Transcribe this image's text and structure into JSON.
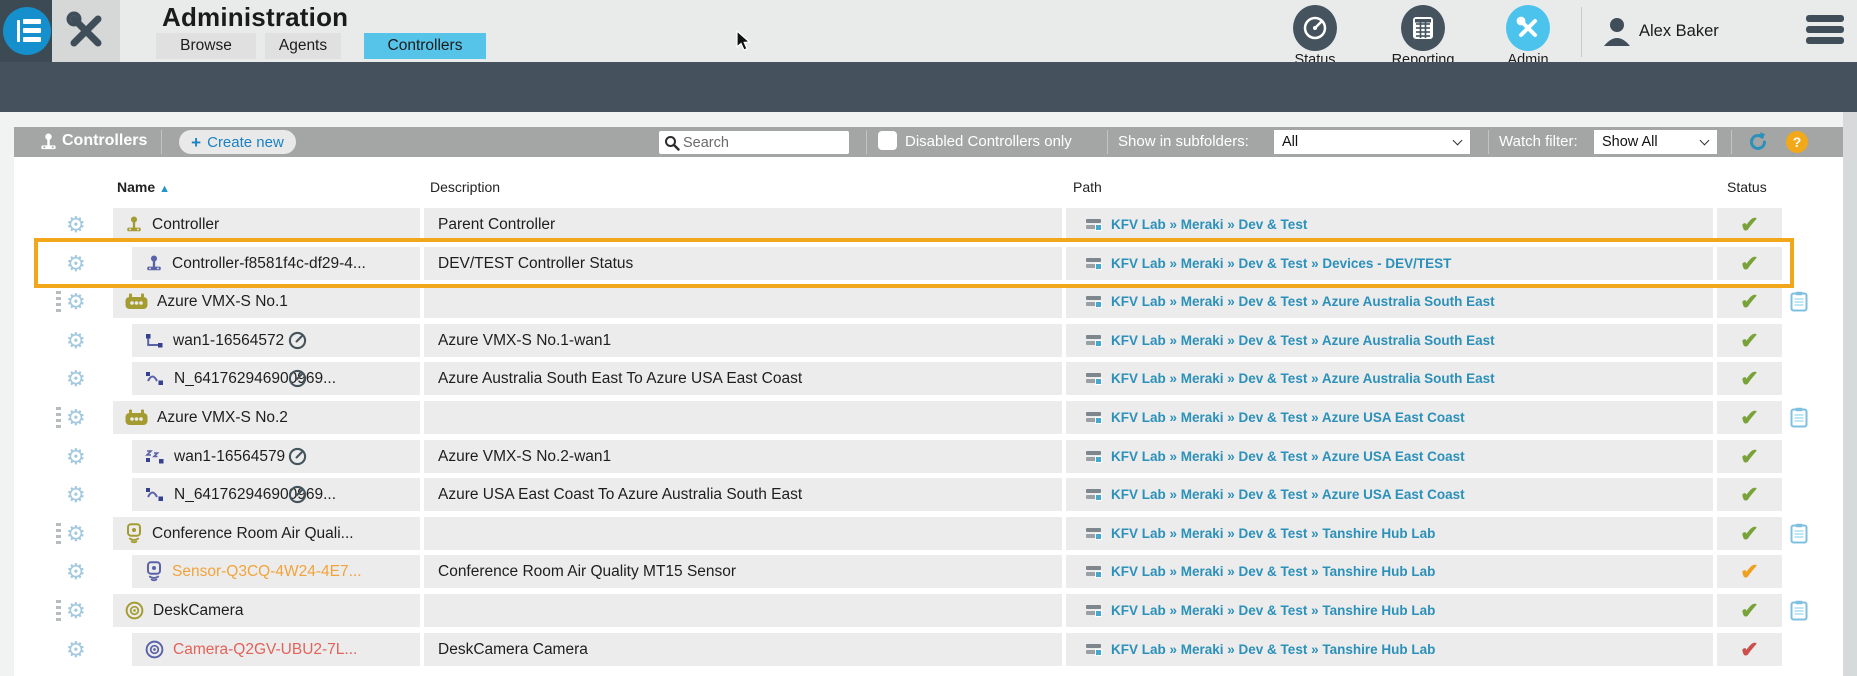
{
  "app": {
    "title": "Administration",
    "tabs": [
      {
        "label": "Browse",
        "active": false
      },
      {
        "label": "Agents",
        "active": false
      },
      {
        "label": "Controllers",
        "active": true
      }
    ],
    "nav_icons": [
      {
        "label": "Status",
        "active": false
      },
      {
        "label": "Reporting",
        "active": false
      },
      {
        "label": "Admin",
        "active": true
      }
    ],
    "user": "Alex Baker"
  },
  "breadcrumb": {
    "folder_label": "KFV Lab"
  },
  "toolbar": {
    "section_label": "Controllers",
    "create_button": "Create new",
    "search_placeholder": "Search",
    "disabled_filter_label": "Disabled Controllers only",
    "subfolders_label": "Show in subfolders:",
    "subfolders_value": "All",
    "watch_filter_label": "Watch filter:",
    "watch_filter_value": "Show All"
  },
  "table": {
    "columns": {
      "name": "Name",
      "description": "Description",
      "path": "Path",
      "status": "Status"
    },
    "rows": [
      {
        "name": "Controller",
        "description": "Parent Controller",
        "path": "KFV Lab » Meraki » Dev & Test",
        "status": "ok",
        "icon": "joystick",
        "tone": "olive",
        "level": "top",
        "gauge": false,
        "handle": false,
        "clipboard": false,
        "highlighted": false
      },
      {
        "name": "Controller-f8581f4c-df29-4...",
        "description": "DEV/TEST Controller Status",
        "path": "KFV Lab » Meraki » Dev & Test » Devices - DEV/TEST",
        "status": "ok",
        "icon": "joystick",
        "tone": "blue",
        "level": "child",
        "gauge": false,
        "handle": false,
        "clipboard": false,
        "highlighted": true
      },
      {
        "name": "Azure VMX-S No.1",
        "description": "",
        "path": "KFV Lab » Meraki » Dev & Test » Azure Australia South East",
        "status": "ok",
        "icon": "robot",
        "tone": "olive",
        "level": "top",
        "gauge": false,
        "handle": true,
        "clipboard": true,
        "highlighted": false
      },
      {
        "name": "wan1-16564572",
        "description": "Azure VMX-S No.1-wan1",
        "path": "KFV Lab » Meraki » Dev & Test » Azure Australia South East",
        "status": "ok",
        "icon": "wan",
        "tone": "blue",
        "level": "child",
        "gauge": true,
        "handle": false,
        "clipboard": false,
        "highlighted": false
      },
      {
        "name": "N_641762946900969...",
        "description": "Azure Australia South East To Azure USA East Coast",
        "path": "KFV Lab » Meraki » Dev & Test » Azure Australia South East",
        "status": "ok",
        "icon": "tunnel",
        "tone": "blue",
        "level": "child",
        "gauge": true,
        "handle": false,
        "clipboard": false,
        "highlighted": false
      },
      {
        "name": "Azure VMX-S No.2",
        "description": "",
        "path": "KFV Lab » Meraki » Dev & Test » Azure USA East Coast",
        "status": "ok",
        "icon": "robot",
        "tone": "olive",
        "level": "top",
        "gauge": false,
        "handle": true,
        "clipboard": true,
        "highlighted": false
      },
      {
        "name": "wan1-16564579",
        "description": "Azure VMX-S No.2-wan1",
        "path": "KFV Lab » Meraki » Dev & Test » Azure USA East Coast",
        "status": "ok",
        "icon": "zz",
        "tone": "blue",
        "level": "child",
        "gauge": true,
        "handle": false,
        "clipboard": false,
        "highlighted": false
      },
      {
        "name": "N_641762946900969...",
        "description": "Azure USA East Coast To Azure Australia South East",
        "path": "KFV Lab » Meraki » Dev & Test » Azure USA East Coast",
        "status": "ok",
        "icon": "tunnel",
        "tone": "blue",
        "level": "child",
        "gauge": true,
        "handle": false,
        "clipboard": false,
        "highlighted": false
      },
      {
        "name": "Conference Room Air Quali...",
        "description": "",
        "path": "KFV Lab » Meraki » Dev & Test » Tanshire Hub Lab",
        "status": "ok",
        "icon": "sensor",
        "tone": "olive",
        "level": "top",
        "gauge": false,
        "handle": true,
        "clipboard": true,
        "highlighted": false
      },
      {
        "name": "Sensor-Q3CQ-4W24-4E7...",
        "description": "Conference Room Air Quality MT15 Sensor",
        "path": "KFV Lab » Meraki » Dev & Test » Tanshire Hub Lab",
        "status": "warn",
        "icon": "sensor",
        "tone": "blue",
        "level": "child",
        "gauge": false,
        "handle": false,
        "clipboard": false,
        "highlighted": false,
        "name_color": "#f2a33c"
      },
      {
        "name": "DeskCamera",
        "description": "",
        "path": "KFV Lab » Meraki » Dev & Test » Tanshire Hub Lab",
        "status": "ok",
        "icon": "camera",
        "tone": "olive",
        "level": "top",
        "gauge": false,
        "handle": true,
        "clipboard": true,
        "highlighted": false
      },
      {
        "name": "Camera-Q2GV-UBU2-7L...",
        "description": "DeskCamera Camera",
        "path": "KFV Lab » Meraki » Dev & Test » Tanshire Hub Lab",
        "status": "error",
        "icon": "camera",
        "tone": "blue",
        "level": "child",
        "gauge": false,
        "handle": false,
        "clipboard": false,
        "highlighted": false,
        "name_color": "#e2635a"
      }
    ]
  },
  "colors": {
    "tab_active": "#56c3e8",
    "link_blue": "#2b90ba",
    "status_ok": "#79a339",
    "status_warn": "#f0a020",
    "status_error": "#c9504c",
    "highlight_orange": "#f2a71b",
    "icon_olive": "#a49b31",
    "icon_blue": "#5b63a8"
  }
}
